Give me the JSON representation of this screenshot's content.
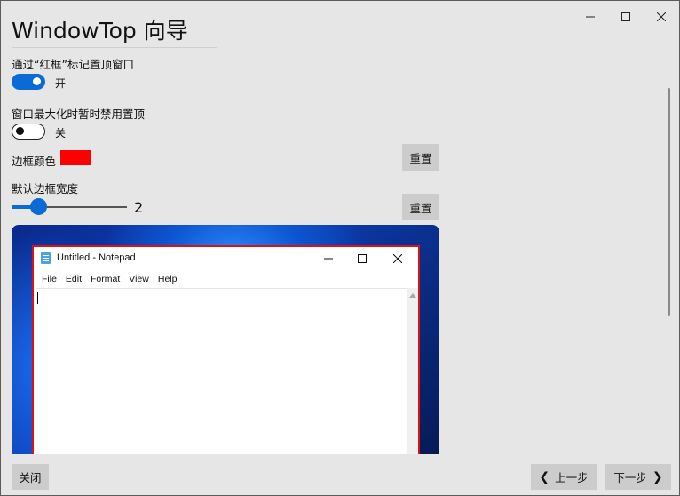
{
  "header": {
    "title": "WindowTop 向导"
  },
  "window_controls": {
    "minimize": "minimize-icon",
    "maximize": "maximize-icon",
    "close": "close-icon"
  },
  "settings": {
    "red_frame": {
      "label": "通过“红框”标记置顶窗口",
      "state": "开",
      "enabled": true
    },
    "disable_on_maximize": {
      "label": "窗口最大化时暂时禁用置顶",
      "state": "关",
      "enabled": false
    },
    "border_color": {
      "label": "边框颜色",
      "color": "#ff0000",
      "reset_label": "重置"
    },
    "border_width": {
      "label": "默认边框宽度",
      "value": "2",
      "min": 0,
      "max": 10,
      "reset_label": "重置"
    }
  },
  "preview": {
    "notepad_title": "Untitled - Notepad",
    "menu": [
      "File",
      "Edit",
      "Format",
      "View",
      "Help"
    ],
    "frame_color": "#e01010"
  },
  "footer": {
    "close_label": "关闭",
    "prev_label": "上一步",
    "next_label": "下一步"
  },
  "colors": {
    "accent": "#0a6ad6",
    "window_bg": "#e6e6e6",
    "button_bg": "#cccccc"
  }
}
